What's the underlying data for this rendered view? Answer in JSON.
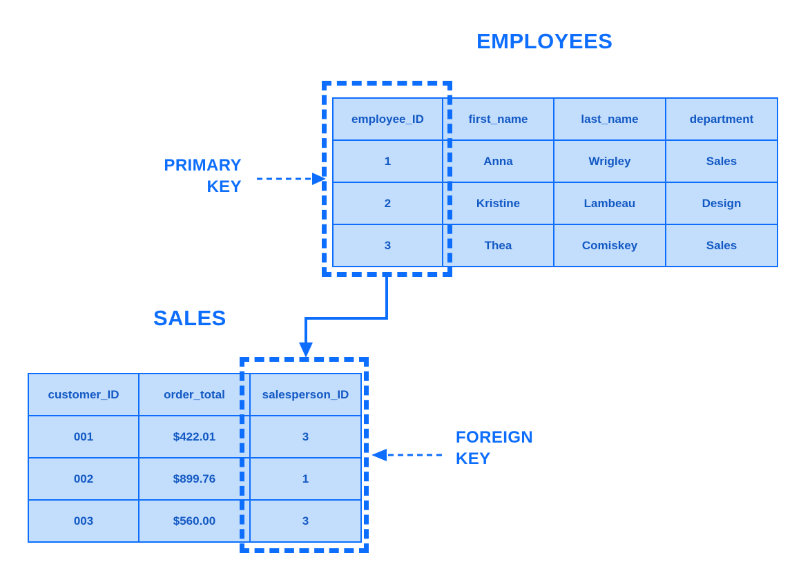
{
  "diagram": {
    "title_employees": "EMPLOYEES",
    "title_sales": "SALES",
    "accent_color": "#0d6efd",
    "cell_fill_color": "#c3ddfd",
    "text_color": "#1259c3",
    "background_color": "#ffffff"
  },
  "employees": {
    "name": "EMPLOYEES",
    "columns": [
      "employee_ID",
      "first_name",
      "last_name",
      "department"
    ],
    "rows": [
      [
        "1",
        "Anna",
        "Wrigley",
        "Sales"
      ],
      [
        "2",
        "Kristine",
        "Lambeau",
        "Design"
      ],
      [
        "3",
        "Thea",
        "Comiskey",
        "Sales"
      ]
    ]
  },
  "sales": {
    "name": "SALES",
    "columns": [
      "customer_ID",
      "order_total",
      "salesperson_ID"
    ],
    "rows": [
      [
        "001",
        "$422.01",
        "3"
      ],
      [
        "002",
        "$899.76",
        "1"
      ],
      [
        "003",
        "$560.00",
        "3"
      ]
    ]
  },
  "annotations": {
    "primary_key": {
      "label": "PRIMARY\nKEY",
      "target_column": "employee_ID",
      "arrow_direction": "right"
    },
    "foreign_key": {
      "label": "FOREIGN\nKEY",
      "target_column": "salesperson_ID",
      "arrow_direction": "left"
    },
    "relationship": {
      "from": "EMPLOYEES.employee_ID",
      "to": "SALES.salesperson_ID"
    }
  }
}
